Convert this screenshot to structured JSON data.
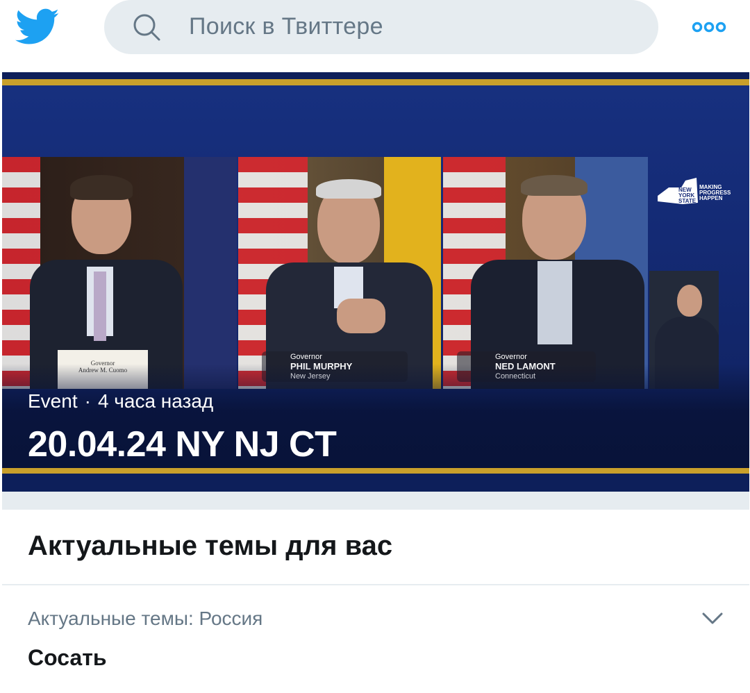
{
  "colors": {
    "brand": "#1da1f2",
    "search_bg": "#e6ecf0",
    "muted_text": "#657786",
    "primary_text": "#14171a"
  },
  "header": {
    "logo_icon": "twitter-bird-icon",
    "search": {
      "placeholder": "Поиск в Твиттере",
      "icon": "search-icon"
    },
    "more_icon": "more-options-icon"
  },
  "event": {
    "category": "Event",
    "separator": "·",
    "time": "4 часа назад",
    "title": "20.04.24 NY NJ CT",
    "image": {
      "panel_1_caption": "Governor\nAndrew M. Cuomo",
      "panel_2_caption_top": "Governor",
      "panel_2_caption_name": "PHIL MURPHY",
      "panel_2_caption_state": "New Jersey",
      "panel_3_caption_top": "Governor",
      "panel_3_caption_name": "NED LAMONT",
      "panel_3_caption_state": "Connecticut",
      "ny_logo_text": "NEW YORK STATE",
      "ny_logo_tagline": "MAKING PROGRESS HAPPEN"
    }
  },
  "trends": {
    "section_title": "Актуальные темы для вас",
    "items": [
      {
        "context": "Актуальные темы: Россия",
        "name": "Сосать",
        "icon": "chevron-down-icon"
      }
    ]
  }
}
